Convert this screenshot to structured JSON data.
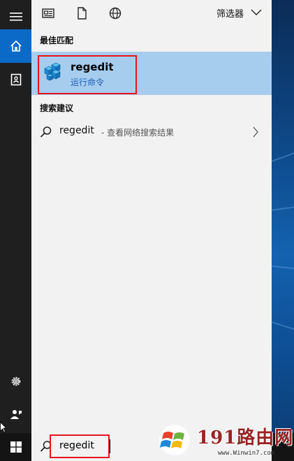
{
  "filter": {
    "label": "筛选器",
    "icons": [
      "news-icon",
      "document-icon",
      "globe-icon"
    ]
  },
  "best_match": {
    "title": "最佳匹配",
    "app_name": "regedit",
    "app_type": "运行命令",
    "icon": "registry-editor-icon"
  },
  "suggestions": {
    "title": "搜索建议",
    "items": [
      {
        "term": "regedit",
        "hint": "- 查看网络搜索结果"
      }
    ]
  },
  "search": {
    "query": "regedit"
  },
  "watermark": {
    "big": "191路由网",
    "small": "www.Winwin7.com"
  },
  "colors": {
    "accent": "#0b6ac8",
    "selected": "#a7cdee",
    "highlight_border": "#e8141c",
    "rail": "#1f1f1f"
  }
}
